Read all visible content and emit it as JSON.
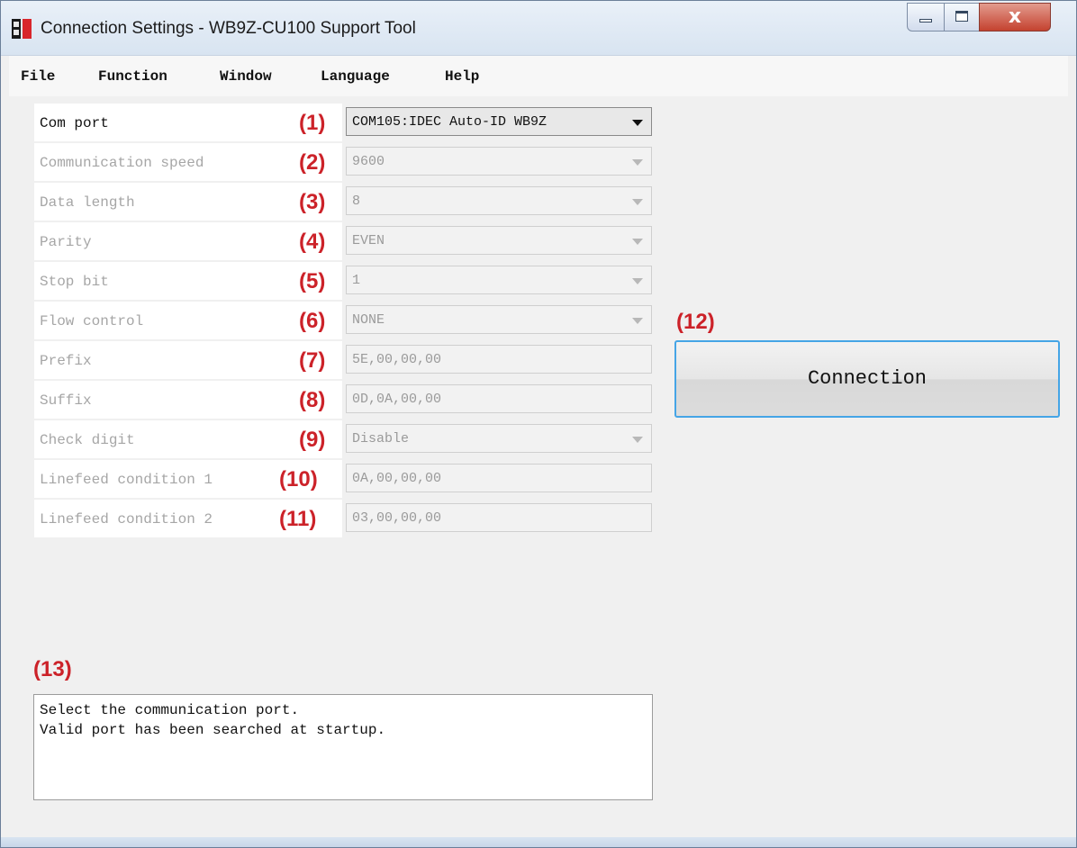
{
  "window": {
    "title": "Connection Settings - WB9Z-CU100 Support Tool",
    "close_glyph": "x"
  },
  "menu": [
    {
      "label": "File"
    },
    {
      "label": "Function"
    },
    {
      "label": "Window"
    },
    {
      "label": "Language"
    },
    {
      "label": "Help"
    }
  ],
  "fields": [
    {
      "label": "Com port",
      "number": "(1)",
      "value": "COM105:IDEC Auto-ID WB9Z",
      "type": "dropdown",
      "enabled": true
    },
    {
      "label": "Communication speed",
      "number": "(2)",
      "value": "9600",
      "type": "dropdown",
      "enabled": false
    },
    {
      "label": "Data length",
      "number": "(3)",
      "value": "8",
      "type": "dropdown",
      "enabled": false
    },
    {
      "label": "Parity",
      "number": "(4)",
      "value": "EVEN",
      "type": "dropdown",
      "enabled": false
    },
    {
      "label": "Stop bit",
      "number": "(5)",
      "value": "1",
      "type": "dropdown",
      "enabled": false
    },
    {
      "label": "Flow control",
      "number": "(6)",
      "value": "NONE",
      "type": "dropdown",
      "enabled": false
    },
    {
      "label": "Prefix",
      "number": "(7)",
      "value": "5E,00,00,00",
      "type": "text",
      "enabled": false
    },
    {
      "label": "Suffix",
      "number": "(8)",
      "value": "0D,0A,00,00",
      "type": "text",
      "enabled": false
    },
    {
      "label": "Check digit",
      "number": "(9)",
      "value": "Disable",
      "type": "dropdown",
      "enabled": false
    },
    {
      "label": "Linefeed condition 1",
      "number": "(10)",
      "value": "0A,00,00,00",
      "type": "text",
      "enabled": false
    },
    {
      "label": "Linefeed condition 2",
      "number": "(11)",
      "value": "03,00,00,00",
      "type": "text",
      "enabled": false
    }
  ],
  "connection": {
    "number": "(12)",
    "label": "Connection"
  },
  "message": {
    "number": "(13)",
    "lines": [
      "Select the communication port.",
      "Valid port has been searched at startup."
    ]
  },
  "colors": {
    "callout": "#cc2229",
    "button_border": "#45a5e6",
    "disabled_text": "#a6a6a6"
  }
}
